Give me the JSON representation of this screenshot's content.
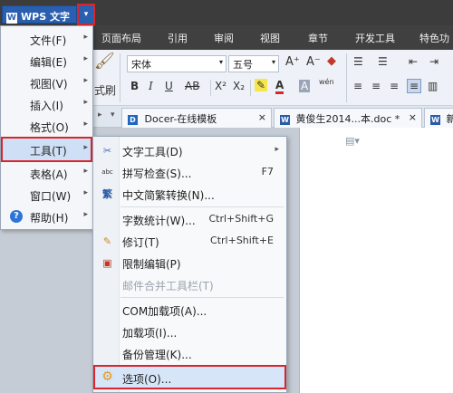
{
  "app": {
    "title": "WPS 文字",
    "arrow": "▾"
  },
  "ribbon_tabs": [
    "页面布局",
    "引用",
    "审阅",
    "视图",
    "章节",
    "开发工具",
    "特色功"
  ],
  "ribbon": {
    "font_name": "宋体",
    "font_size": "五号",
    "format_painter": "式刷",
    "bold": "B",
    "italic": "I",
    "underline": "U",
    "strike": "AB",
    "superscript": "X²",
    "subscript": "X₂",
    "font_grow": "A⁺",
    "font_shrink": "A⁻",
    "font_color": "A",
    "char_border": "A",
    "phonetic": "wén"
  },
  "doc_tabs": [
    {
      "label": "Docer-在线模板",
      "close": "×"
    },
    {
      "label": "黄俊生2014...本.doc *",
      "close": "×"
    },
    {
      "label": "新"
    }
  ],
  "app_menu": [
    {
      "label": "文件(F)",
      "arrow": "▸"
    },
    {
      "label": "编辑(E)",
      "arrow": "▸"
    },
    {
      "label": "视图(V)",
      "arrow": "▸"
    },
    {
      "label": "插入(I)",
      "arrow": "▸"
    },
    {
      "label": "格式(O)",
      "arrow": "▸"
    },
    {
      "label": "工具(T)",
      "arrow": "▸",
      "selected": true
    },
    {
      "label": "表格(A)",
      "arrow": "▸"
    },
    {
      "label": "窗口(W)",
      "arrow": "▸"
    },
    {
      "label": "帮助(H)",
      "arrow": "▸",
      "icon": "help-icon"
    }
  ],
  "tools_menu": [
    {
      "label": "文字工具(D)",
      "arrow": "▸",
      "icon": "text-tool-icon"
    },
    {
      "label": "拼写检查(S)...",
      "shortcut": "F7",
      "icon": "spellcheck-icon"
    },
    {
      "label": "中文简繁转换(N)...",
      "icon": "chinese-convert-icon"
    },
    {
      "label": "字数统计(W)...",
      "shortcut": "Ctrl+Shift+G"
    },
    {
      "label": "修订(T)",
      "shortcut": "Ctrl+Shift+E",
      "icon": "track-changes-icon"
    },
    {
      "label": "限制编辑(P)",
      "icon": "restrict-edit-icon"
    },
    {
      "label": "邮件合并工具栏(T)",
      "disabled": true
    },
    {
      "label": "COM加载项(A)..."
    },
    {
      "label": "加载项(I)..."
    },
    {
      "label": "备份管理(K)..."
    },
    {
      "label": "选项(O)...",
      "selected": true,
      "icon": "gear-icon"
    }
  ],
  "colors": {
    "accent_red": "#d9262b",
    "wps_blue": "#2a5fb0",
    "menu_highlight": "#cfe0f6"
  }
}
